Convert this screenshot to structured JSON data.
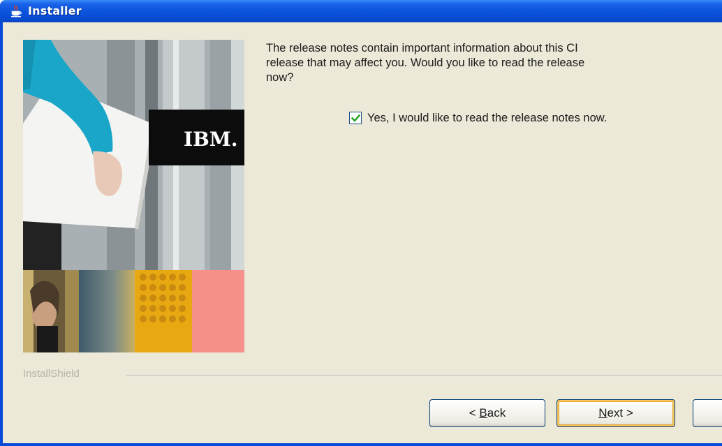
{
  "window": {
    "title": "Installer"
  },
  "side_image": {
    "logo_text": "IBM."
  },
  "message": {
    "line1": "The release notes contain important information about this CI",
    "line2": "release that may affect you. Would you like to read the release",
    "line3": "now?"
  },
  "checkbox": {
    "label": "Yes, I would like to read the release notes now.",
    "checked": true
  },
  "footer": {
    "brand": "InstallShield"
  },
  "buttons": {
    "back_prefix": "< ",
    "back_mnemonic": "B",
    "back_rest": "ack",
    "next_mnemonic": "N",
    "next_rest": "ext >"
  },
  "colors": {
    "titlebar": "#0a54dc",
    "client_bg": "#ece9d8",
    "checkmark": "#21a121"
  }
}
